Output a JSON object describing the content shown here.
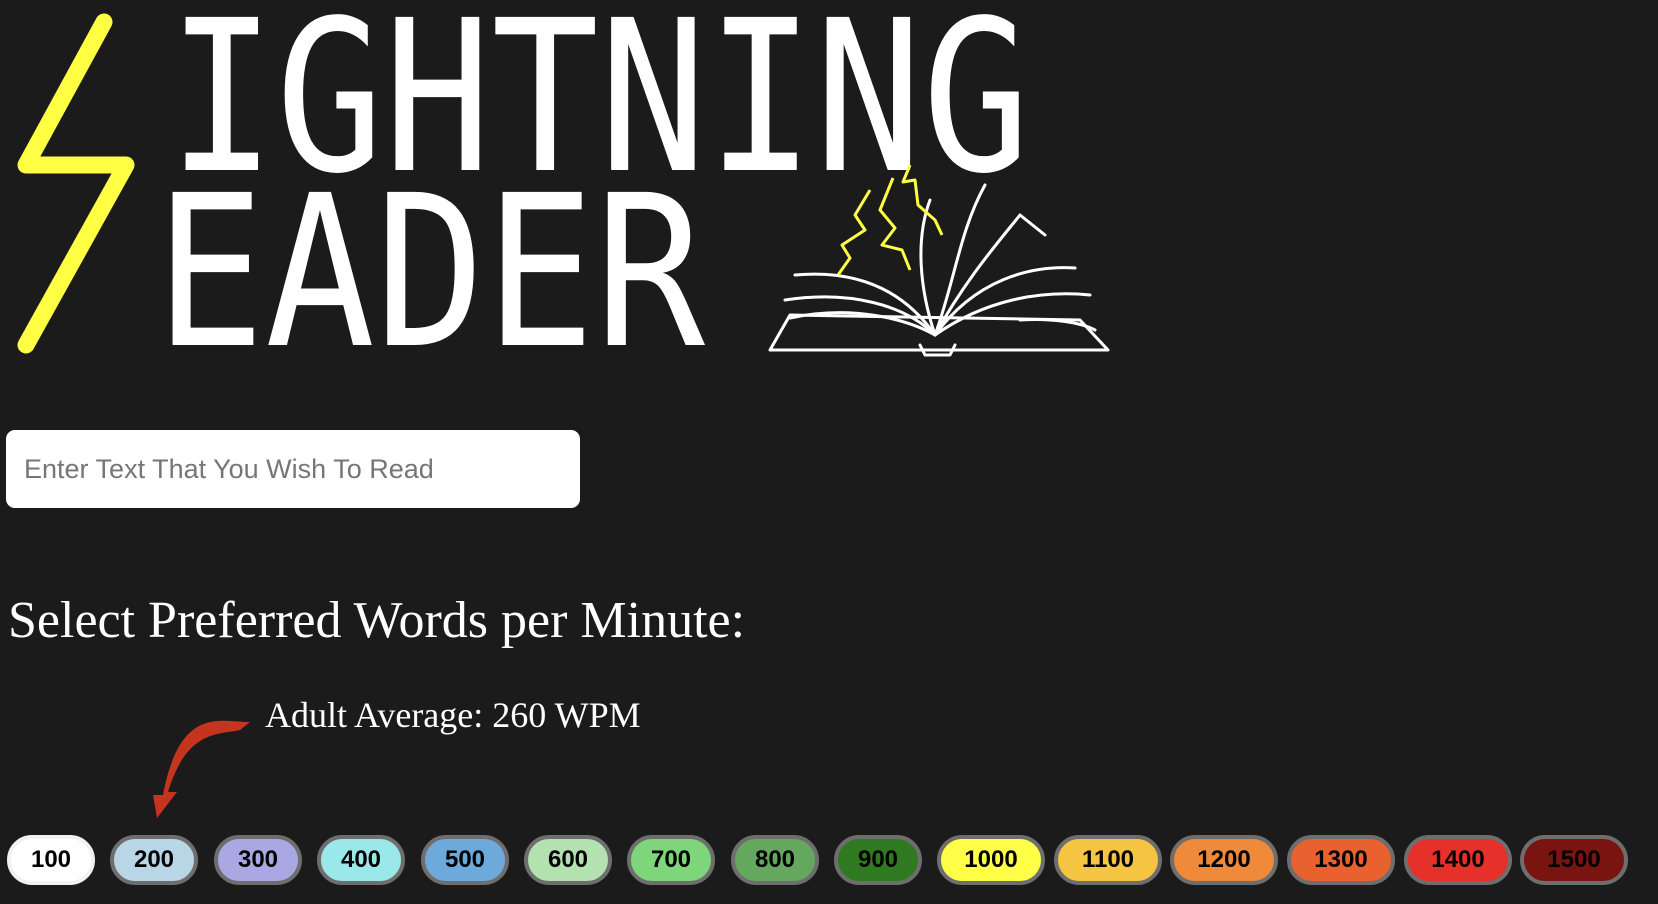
{
  "logo": {
    "line1": "IGHTNING",
    "line2": "EADER",
    "bolt_color": "#ffff44",
    "text_color": "#ffffff"
  },
  "input": {
    "placeholder": "Enter Text That You Wish To Read",
    "value": ""
  },
  "heading": "Select Preferred Words per Minute:",
  "annotation": {
    "text": "Adult Average: 260 WPM",
    "arrow_color": "#c5341e"
  },
  "wpm_options": [
    {
      "label": "100",
      "color": "#ffffff",
      "selected": true
    },
    {
      "label": "200",
      "color": "#b9d6e6",
      "selected": false
    },
    {
      "label": "300",
      "color": "#a9a8e2",
      "selected": false
    },
    {
      "label": "400",
      "color": "#9be8ea",
      "selected": false
    },
    {
      "label": "500",
      "color": "#6ea9db",
      "selected": false
    },
    {
      "label": "600",
      "color": "#b4e1b0",
      "selected": false
    },
    {
      "label": "700",
      "color": "#7fd67a",
      "selected": false
    },
    {
      "label": "800",
      "color": "#64a85e",
      "selected": false
    },
    {
      "label": "900",
      "color": "#2f7a21",
      "selected": false
    },
    {
      "label": "1000",
      "color": "#ffff48",
      "selected": false
    },
    {
      "label": "1100",
      "color": "#f6c443",
      "selected": false
    },
    {
      "label": "1200",
      "color": "#ee8a3a",
      "selected": false
    },
    {
      "label": "1300",
      "color": "#e8612e",
      "selected": false
    },
    {
      "label": "1400",
      "color": "#e6302a",
      "selected": false
    },
    {
      "label": "1500",
      "color": "#7a1410",
      "selected": false
    }
  ]
}
